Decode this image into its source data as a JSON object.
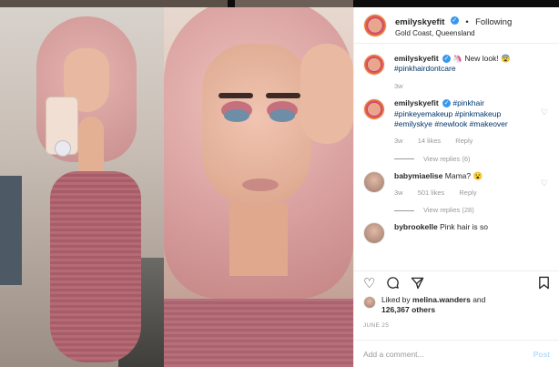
{
  "post": {
    "username": "emilyskyefit",
    "verified_badge": "✓",
    "follow_separator": "•",
    "follow_label": "Following",
    "location": "Gold Coast, Queensland"
  },
  "comments": [
    {
      "username": "emilyskyefit",
      "text_prefix": "🦄 New look! 😨",
      "hashtags": "#pinkhairdontcare",
      "time": "3w",
      "likes": "",
      "reply": "",
      "view_replies": "",
      "has_heart": false
    },
    {
      "username": "emilyskyefit",
      "text_prefix": "",
      "hashtags": "#pinkhair #pinkeyemakeup #pinkmakeup #emilyskye #newlook #makeover",
      "time": "3w",
      "likes": "14 likes",
      "reply": "Reply",
      "view_replies": "View replies (6)",
      "has_heart": true
    },
    {
      "username": "babymiaelise",
      "text_prefix": "Mama? 😮",
      "hashtags": "",
      "time": "3w",
      "likes": "501 likes",
      "reply": "Reply",
      "view_replies": "View replies (28)",
      "has_heart": true
    },
    {
      "username": "bybrookelle",
      "text_prefix": "Pink hair is so",
      "hashtags": "",
      "time": "",
      "likes": "",
      "reply": "",
      "view_replies": "",
      "has_heart": false
    }
  ],
  "actions": {
    "like_icon": "heart-outline-icon",
    "comment_icon": "comment-icon",
    "share_icon": "share-icon",
    "save_icon": "bookmark-icon"
  },
  "likes_summary": {
    "prefix": "Liked by",
    "user": "melina.wanders",
    "joiner": "and",
    "count": "126,367 others"
  },
  "date": "JUNE 25",
  "add_comment": {
    "placeholder": "Add a comment...",
    "post_label": "Post"
  },
  "colors": {
    "link": "#003569",
    "verified": "#3897f0",
    "post_disabled": "#b2dffc",
    "muted": "#999999"
  }
}
